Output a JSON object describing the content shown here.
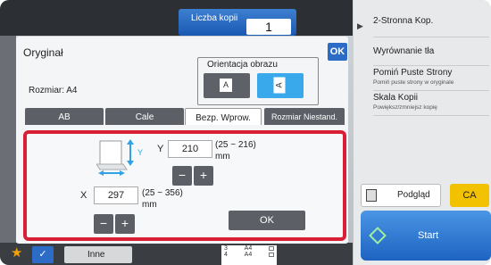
{
  "header": {
    "copies_label": "Liczba kopii",
    "copies_value": "1"
  },
  "right_panel": {
    "items": [
      {
        "title": "2-Stronna Kop.",
        "sub": ""
      },
      {
        "title": "Wyrównanie tła",
        "sub": ""
      },
      {
        "title": "Pomiń Puste Strony",
        "sub": "Pomiń puste strony w oryginale"
      },
      {
        "title": "Skala Kopii",
        "sub": "Powiększ/zmniejsz kopię"
      }
    ],
    "preview_label": "Podgląd",
    "ca_label": "CA",
    "start_label": "Start"
  },
  "bottom": {
    "other_label": "Inne",
    "mini_rows": [
      {
        "num": "3",
        "size": "A4"
      },
      {
        "num": "4",
        "size": "A4"
      }
    ]
  },
  "dialog": {
    "title": "Oryginał",
    "ok_top": "OK",
    "orientation_label": "Orientacja obrazu",
    "orientation_a": "A",
    "orientation_b": "A",
    "size_label": "Rozmiar: A4",
    "tabs": [
      {
        "label": "AB",
        "active": false
      },
      {
        "label": "Cale",
        "active": false
      },
      {
        "label": "Bezp. Wprow.",
        "active": true
      },
      {
        "label": "Rozmiar Niestand.",
        "active": false
      }
    ],
    "y_label": "Y",
    "y_value": "210",
    "y_range": "(25 ~ 216)",
    "y_unit": "mm",
    "x_label": "X",
    "x_value": "297",
    "x_range": "(25 ~ 356)",
    "x_unit": "mm",
    "minus": "−",
    "plus": "+",
    "icon_y": "Y",
    "icon_x": "X",
    "ok_bottom": "OK"
  },
  "colors": {
    "accent": "#2d6cc6",
    "highlight_frame": "#d81f36",
    "orientation_selected": "#39a9ec",
    "ca": "#f2c100"
  }
}
